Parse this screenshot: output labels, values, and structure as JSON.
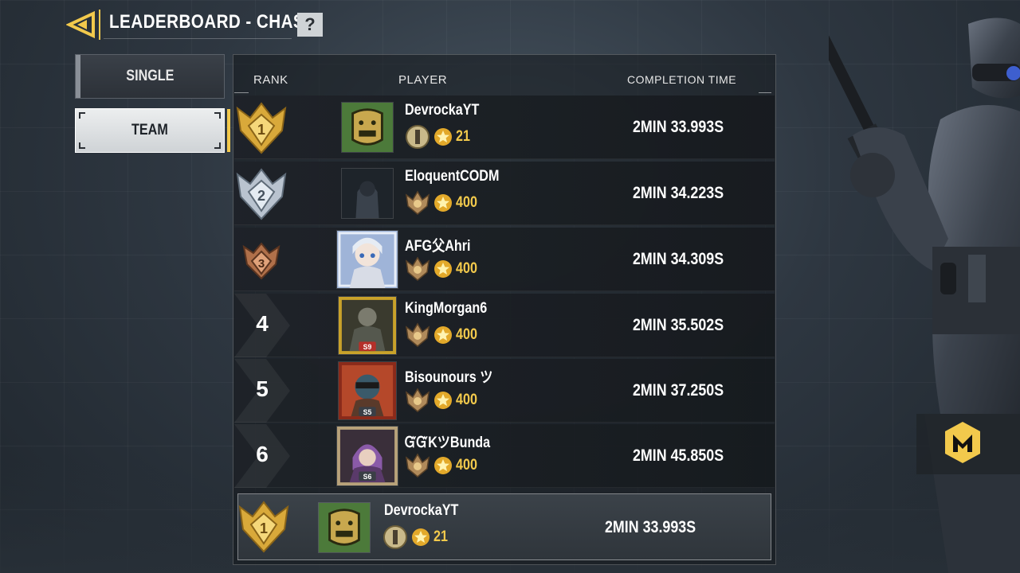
{
  "header": {
    "title": "LEADERBOARD - CHASE",
    "help_label": "?"
  },
  "tabs": [
    {
      "label": "SINGLE",
      "selected": false
    },
    {
      "label": "TEAM",
      "selected": true
    }
  ],
  "table": {
    "columns": {
      "rank": "RANK",
      "player": "PLAYER",
      "time": "COMPLETION TIME"
    },
    "rows": [
      {
        "rank": "1",
        "name": "DevrockaYT",
        "level": "21",
        "time": "2MIN 33.993S",
        "medal": "gold"
      },
      {
        "rank": "2",
        "name": "EloquentCODM",
        "level": "400",
        "time": "2MIN 34.223S",
        "medal": "silver"
      },
      {
        "rank": "3",
        "name": "AFG父Ahri",
        "level": "400",
        "time": "2MIN 34.309S",
        "medal": "bronze"
      },
      {
        "rank": "4",
        "name": "KingMorgan6",
        "level": "400",
        "time": "2MIN 35.502S",
        "medal": "none"
      },
      {
        "rank": "5",
        "name": "Bisounours ツ",
        "level": "400",
        "time": "2MIN 37.250S",
        "medal": "none"
      },
      {
        "rank": "6",
        "name": "ᏳᏳKツBunda",
        "level": "400",
        "time": "2MIN 45.850S",
        "medal": "none"
      }
    ]
  },
  "my_entry": {
    "rank": "1",
    "name": "DevrockaYT",
    "level": "21",
    "time": "2MIN 33.993S"
  },
  "avatar_badges": {
    "r4": "S9",
    "r5": "S5",
    "r6": "S6"
  },
  "colors": {
    "accent": "#f2c94c",
    "gold": "#d9a93a",
    "silver": "#b9c3cf",
    "bronze": "#b0704a"
  },
  "icons": {
    "back": "back-arrow-icon",
    "help": "help-icon",
    "star": "star-icon",
    "logo": "codm-logo-icon"
  }
}
